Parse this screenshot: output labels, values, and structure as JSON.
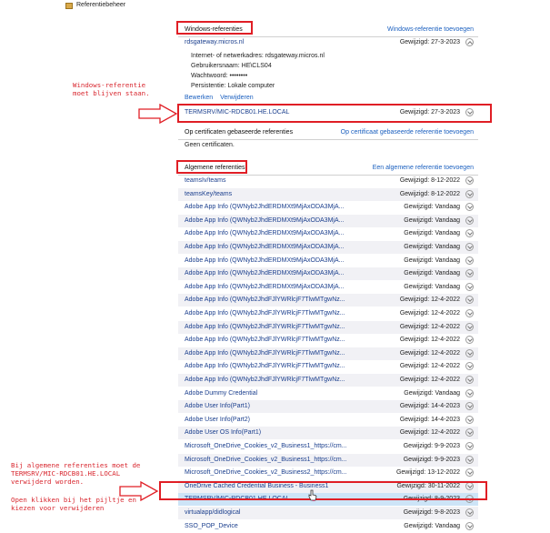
{
  "window": {
    "title": "Referentiebeheer"
  },
  "windows_section": {
    "heading": "Windows-referenties",
    "add_link": "Windows-referentie toevoegen",
    "expanded": {
      "name": "rdsgateway.micros.nl",
      "modified": "Gewijzigd:  27-3-2023",
      "address": "Internet- of netwerkadres:  rdsgateway.micros.nl",
      "username": "Gebruikersnaam:  HE\\CLS04",
      "password": "Wachtwoord:  ••••••••",
      "persistence": "Persistentie:  Lokale computer",
      "edit": "Bewerken",
      "remove": "Verwijderen"
    },
    "termsrv": {
      "name": "TERMSRV/MIC-RDCB01.HE.LOCAL",
      "modified": "Gewijzigd:  27-3-2023"
    }
  },
  "cert_section": {
    "heading": "Op certificaten gebaseerde referenties",
    "add_link": "Op certificaat gebaseerde referentie toevoegen",
    "empty": "Geen certificaten."
  },
  "general_section": {
    "heading": "Algemene referenties",
    "add_link": "Een algemene referentie toevoegen",
    "items": [
      {
        "name": "teamsIv/teams",
        "modified": "Gewijzigd:  8-12-2022"
      },
      {
        "name": "teamsKey/teams",
        "modified": "Gewijzigd:  8-12-2022"
      },
      {
        "name": "Adobe App Info (QWNyb2JhdERDMXt9MjAxODA3MjA...",
        "modified": "Gewijzigd:  Vandaag"
      },
      {
        "name": "Adobe App Info (QWNyb2JhdERDMXt9MjAxODA3MjA...",
        "modified": "Gewijzigd:  Vandaag"
      },
      {
        "name": "Adobe App Info (QWNyb2JhdERDMXt9MjAxODA3MjA...",
        "modified": "Gewijzigd:  Vandaag"
      },
      {
        "name": "Adobe App Info (QWNyb2JhdERDMXt9MjAxODA3MjA...",
        "modified": "Gewijzigd:  Vandaag"
      },
      {
        "name": "Adobe App Info (QWNyb2JhdERDMXt9MjAxODA3MjA...",
        "modified": "Gewijzigd:  Vandaag"
      },
      {
        "name": "Adobe App Info (QWNyb2JhdERDMXt9MjAxODA3MjA...",
        "modified": "Gewijzigd:  Vandaag"
      },
      {
        "name": "Adobe App Info (QWNyb2JhdERDMXt9MjAxODA3MjA...",
        "modified": "Gewijzigd:  Vandaag"
      },
      {
        "name": "Adobe App Info (QWNyb2JhdFJlYWRlcjF7TlwMTgwNz...",
        "modified": "Gewijzigd:  12-4-2022"
      },
      {
        "name": "Adobe App Info (QWNyb2JhdFJlYWRlcjF7TlwMTgwNz...",
        "modified": "Gewijzigd:  12-4-2022"
      },
      {
        "name": "Adobe App Info (QWNyb2JhdFJlYWRlcjF7TlwMTgwNz...",
        "modified": "Gewijzigd:  12-4-2022"
      },
      {
        "name": "Adobe App Info (QWNyb2JhdFJlYWRlcjF7TlwMTgwNz...",
        "modified": "Gewijzigd:  12-4-2022"
      },
      {
        "name": "Adobe App Info (QWNyb2JhdFJlYWRlcjF7TlwMTgwNz...",
        "modified": "Gewijzigd:  12-4-2022"
      },
      {
        "name": "Adobe App Info (QWNyb2JhdFJlYWRlcjF7TlwMTgwNz...",
        "modified": "Gewijzigd:  12-4-2022"
      },
      {
        "name": "Adobe App Info (QWNyb2JhdFJlYWRlcjF7TlwMTgwNz...",
        "modified": "Gewijzigd:  12-4-2022"
      },
      {
        "name": "Adobe Dummy Credential",
        "modified": "Gewijzigd:  Vandaag"
      },
      {
        "name": "Adobe User Info(Part1)",
        "modified": "Gewijzigd:  14-4-2023"
      },
      {
        "name": "Adobe User Info(Part2)",
        "modified": "Gewijzigd:  14-4-2023"
      },
      {
        "name": "Adobe User OS Info(Part1)",
        "modified": "Gewijzigd:  12-4-2022"
      },
      {
        "name": "Microsoft_OneDrive_Cookies_v2_Business1_https://cm...",
        "modified": "Gewijzigd:  9-9-2023"
      },
      {
        "name": "Microsoft_OneDrive_Cookies_v2_Business1_https://cm...",
        "modified": "Gewijzigd:  9-9-2023"
      },
      {
        "name": "Microsoft_OneDrive_Cookies_v2_Business2_https://cm...",
        "modified": "Gewijzigd:  13-12-2022"
      },
      {
        "name": "OneDrive Cached Credential Business - Business1",
        "modified": "Gewijzigd:  30-11-2022"
      },
      {
        "name": "TERMSRV/MIC-RDCB01.HE.LOCAL",
        "modified": "Gewijzigd:  8-9-2023"
      },
      {
        "name": "virtualapp/didlogical",
        "modified": "Gewijzigd:  9-8-2023"
      },
      {
        "name": "SSO_POP_Device",
        "modified": "Gewijzigd:  Vandaag"
      }
    ]
  },
  "annotations": {
    "note1": "Windows-referentie\nmoet blijven staan.",
    "note2": "Bij algemene referenties moet de\nTERMSRV/MIC-RDCB01.HE.LOCAL\nverwijderd worden.",
    "note3": "Open klikken bij het pijltje en\nkiezen voor verwijderen"
  },
  "colors": {
    "annotation_red": "#e01e25",
    "link_blue": "#1a5fbf",
    "selected_row": "#cde4f7"
  }
}
